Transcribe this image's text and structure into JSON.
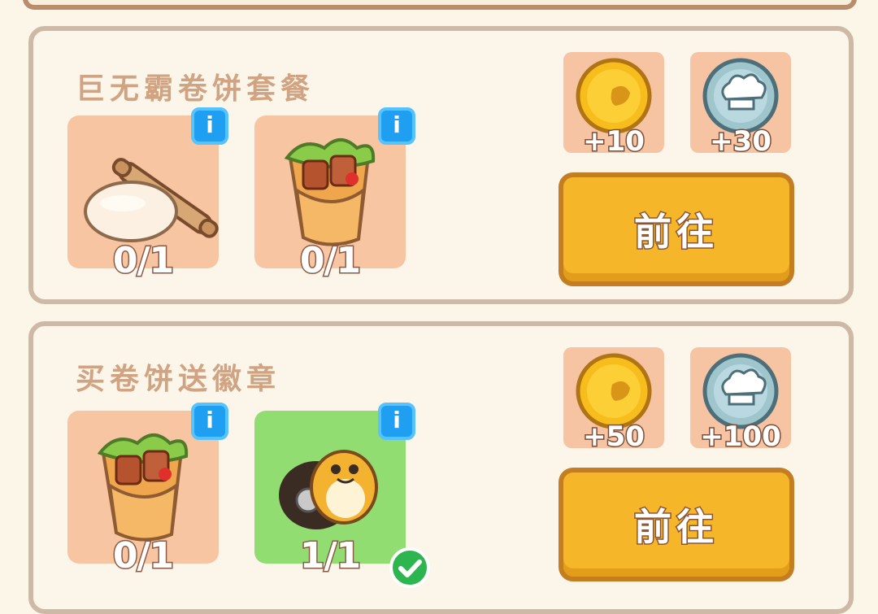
{
  "tasks": [
    {
      "title": "巨无霸卷饼套餐",
      "requirements": [
        {
          "item": "dough",
          "count": "0/1",
          "info": "i"
        },
        {
          "item": "wrap",
          "count": "0/1",
          "info": "i"
        }
      ],
      "rewards": [
        {
          "currency": "gold-coin",
          "amount": "+10"
        },
        {
          "currency": "chef-coin",
          "amount": "+30"
        }
      ],
      "button_label": "前往"
    },
    {
      "title": "买卷饼送徽章",
      "requirements": [
        {
          "item": "wrap",
          "count": "0/1",
          "info": "i"
        },
        {
          "item": "badge",
          "count": "1/1",
          "info": "i",
          "completed": true
        }
      ],
      "rewards": [
        {
          "currency": "gold-coin",
          "amount": "+50"
        },
        {
          "currency": "chef-coin",
          "amount": "+100"
        }
      ],
      "button_label": "前往"
    }
  ],
  "colors": {
    "slot": "#f7c5a2",
    "slot_done": "#92dd72",
    "button": "#f6b62a",
    "info_badge": "#1e9ff2",
    "check_badge": "#2db54f"
  }
}
